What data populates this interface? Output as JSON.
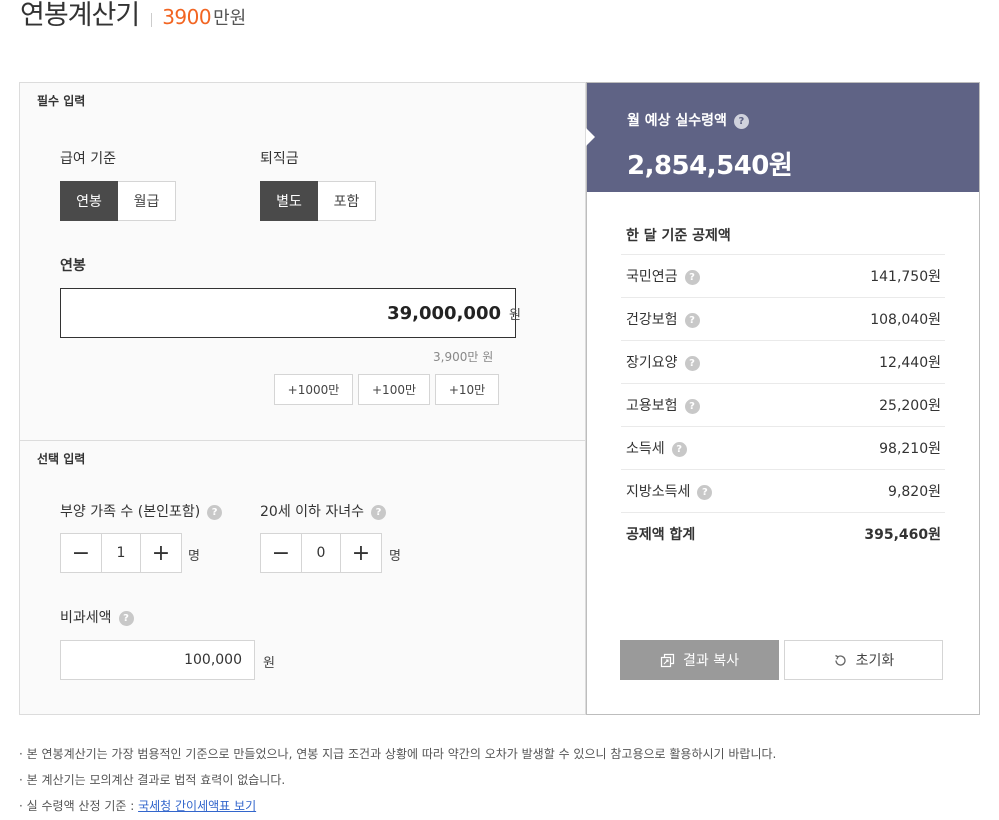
{
  "header": {
    "title": "연봉계산기",
    "amount": "3900",
    "unit": "만원"
  },
  "required": {
    "section_label": "필수 입력",
    "pay_basis": {
      "label": "급여 기준",
      "options": [
        "연봉",
        "월급"
      ],
      "selected": "연봉"
    },
    "severance": {
      "label": "퇴직금",
      "options": [
        "별도",
        "포함"
      ],
      "selected": "별도"
    },
    "salary": {
      "label": "연봉",
      "value": "39,000,000",
      "unit": "원",
      "hint_value": "3,900만",
      "hint_unit": "원"
    },
    "quick_add": [
      "+1000만",
      "+100만",
      "+10만"
    ]
  },
  "optional": {
    "section_label": "선택 입력",
    "dependents": {
      "label": "부양 가족 수 (본인포함)",
      "value": "1",
      "unit": "명",
      "minus": "−",
      "plus": "+"
    },
    "children": {
      "label": "20세 이하 자녀수",
      "value": "0",
      "unit": "명",
      "minus": "−",
      "plus": "+"
    },
    "nontaxable": {
      "label": "비과세액",
      "value": "100,000",
      "unit": "원"
    },
    "help_glyph": "?"
  },
  "result": {
    "label": "월 예상 실수령액",
    "value": "2,854,540원",
    "deduction_title": "한 달 기준 공제액",
    "deductions": [
      {
        "name": "국민연금",
        "value": "141,750원"
      },
      {
        "name": "건강보험",
        "value": "108,040원"
      },
      {
        "name": "장기요양",
        "value": "12,440원"
      },
      {
        "name": "고용보험",
        "value": "25,200원"
      },
      {
        "name": "소득세",
        "value": "98,210원"
      },
      {
        "name": "지방소득세",
        "value": "9,820원"
      }
    ],
    "total": {
      "name": "공제액 합계",
      "value": "395,460원"
    },
    "copy_button": "결과 복사",
    "reset_button": "초기화"
  },
  "notes": {
    "line1": "· 본 연봉계산기는 가장 범용적인 기준으로 만들었으나, 연봉 지급 조건과 상황에 따라 약간의 오차가 발생할 수 있으니 참고용으로 활용하시기 바랍니다.",
    "line2": "· 본 계산기는 모의계산 결과로 법적 효력이 없습니다.",
    "line3_prefix": "· 실 수령액 산정 기준 : ",
    "line3_link": "국세청 간이세액표 보기"
  },
  "colors": {
    "accent_orange": "#f26522",
    "result_header": "#5f6385",
    "active_segment": "#4a4a4a",
    "copy_button": "#9a9a9a",
    "link": "#3366cc"
  }
}
